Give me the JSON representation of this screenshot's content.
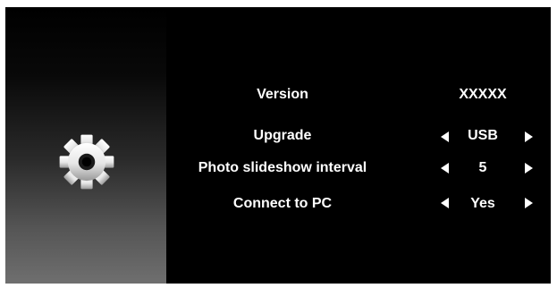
{
  "settings_menu": {
    "rows": [
      {
        "label": "Version",
        "value": "XXXXX",
        "adjustable": false
      },
      {
        "label": "Upgrade",
        "value": "USB",
        "adjustable": true
      },
      {
        "label": "Photo slideshow interval",
        "value": "5",
        "adjustable": true
      },
      {
        "label": "Connect to PC",
        "value": "Yes",
        "adjustable": true
      }
    ]
  },
  "icons": {
    "sidebar": "gear-icon",
    "decrease": "arrow-left-icon",
    "increase": "arrow-right-icon"
  },
  "colors": {
    "background": "#000000",
    "text": "#ffffff",
    "sidebar_gradient_top": "#000000",
    "sidebar_gradient_bottom": "#6f6f6f",
    "frame": "#ffffff"
  }
}
